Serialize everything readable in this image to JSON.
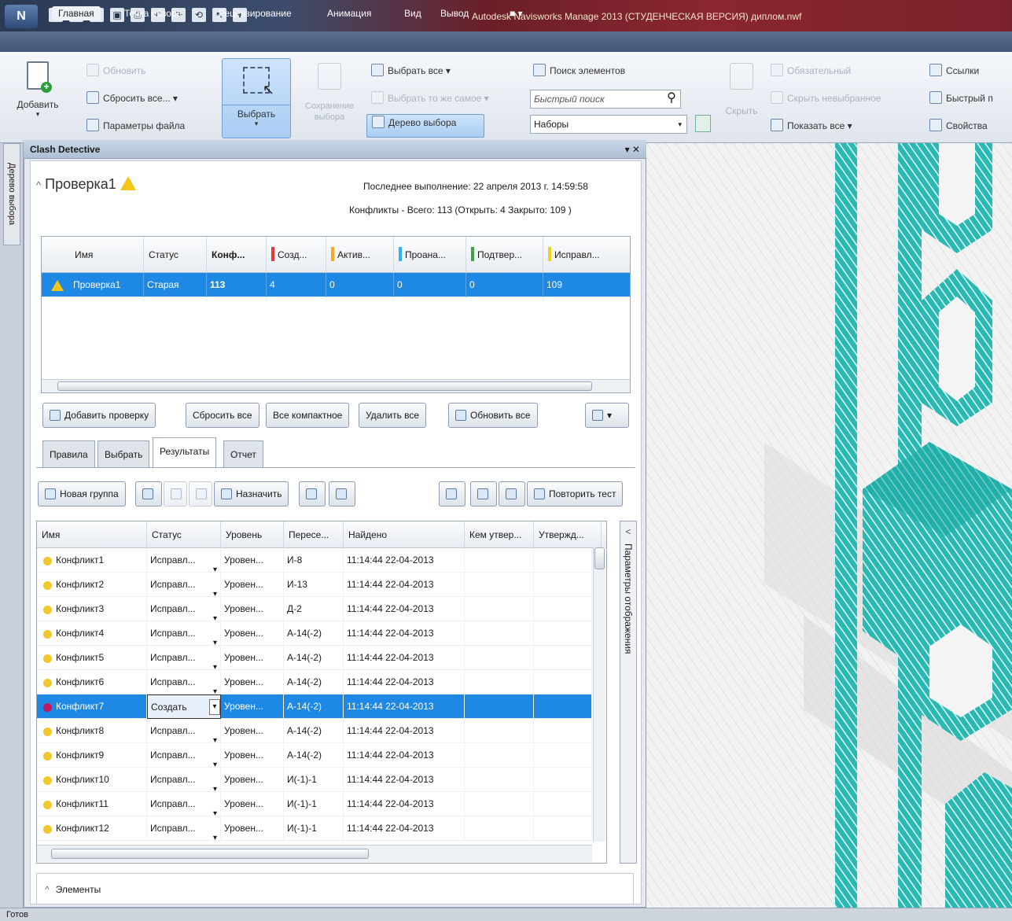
{
  "app": {
    "title": "Autodesk Navisworks Manage 2013 (СТУДЕНЧЕСКАЯ ВЕРСИЯ)  диплом.nwf",
    "menu_button": "N"
  },
  "quick_access": [
    "▢",
    "▤",
    "▾",
    "▣",
    "⎙",
    "↶",
    "↷",
    "⟲",
    "↖",
    "▾"
  ],
  "tabs": [
    "Главная",
    "Точка обзора",
    "Рецензирование",
    "Анимация",
    "Вид",
    "Вывод",
    "■ ▾"
  ],
  "ribbon": {
    "add": "Добавить",
    "refresh": "Обновить",
    "reset_all": "Сбросить все... ▾",
    "file_params": "Параметры файла",
    "select": "Выбрать",
    "save_selection": "Сохранение выбора",
    "select_all": "Выбрать все ▾",
    "select_same": "Выбрать то же самое ▾",
    "selection_tree": "Дерево выбора",
    "find_items": "Поиск элементов",
    "quick_search_placeholder": "Быстрый поиск",
    "sets": "Наборы",
    "hide": "Скрыть",
    "required": "Обязательный",
    "hide_unselected": "Скрыть невыбранное",
    "show_all": "Показать все ▾",
    "links": "Ссылки",
    "quick_props": "Быстрый п",
    "properties": "Свойства"
  },
  "side_tab": "Дерево выбора",
  "status_bar": "Готов",
  "clash": {
    "panel_title": "Clash Detective",
    "panel_controls": "▾ ✕",
    "test_name": "Проверка1",
    "last_run": "Последнее выполнение:  22 апреля 2013 г. 14:59:58",
    "summary": "Конфликты - Всего: 113  (Открыть: 4  Закрыто: 109 )",
    "tests_columns": [
      "Имя",
      "Статус",
      "Конф...",
      "Созд...",
      "Актив...",
      "Проана...",
      "Подтвер...",
      "Исправл..."
    ],
    "tests_column_colors": [
      "",
      "",
      "",
      "#e53935",
      "#f5a623",
      "#29b6f6",
      "#43a047",
      "#f1d21c"
    ],
    "tests_row": [
      "Проверка1",
      "Старая",
      "113",
      "4",
      "0",
      "0",
      "0",
      "109"
    ],
    "test_buttons": {
      "add_test": "Добавить проверку",
      "reset_all": "Сбросить все",
      "compact_all": "Все компактное",
      "delete_all": "Удалить все",
      "update_all": "Обновить все"
    },
    "sub_tabs": [
      "Правила",
      "Выбрать",
      "Результаты",
      "Отчет"
    ],
    "results_toolbar": {
      "new_group": "Новая группа",
      "assign": "Назначить",
      "rerun": "Повторить тест"
    },
    "results_columns": [
      "Имя",
      "Статус",
      "Уровень",
      "Пересе...",
      "Найдено",
      "Кем утвер...",
      "Утвержд..."
    ],
    "results": [
      {
        "name": "Конфликт1",
        "status": "Исправл...",
        "level": "Уровен...",
        "grid": "И-8",
        "found": "11:14:44 22-04-2013",
        "dot": "#f2c72c"
      },
      {
        "name": "Конфликт2",
        "status": "Исправл...",
        "level": "Уровен...",
        "grid": "И-13",
        "found": "11:14:44 22-04-2013",
        "dot": "#f2c72c"
      },
      {
        "name": "Конфликт3",
        "status": "Исправл...",
        "level": "Уровен...",
        "grid": "Д-2",
        "found": "11:14:44 22-04-2013",
        "dot": "#f2c72c"
      },
      {
        "name": "Конфликт4",
        "status": "Исправл...",
        "level": "Уровен...",
        "grid": "А-14(-2)",
        "found": "11:14:44 22-04-2013",
        "dot": "#f2c72c"
      },
      {
        "name": "Конфликт5",
        "status": "Исправл...",
        "level": "Уровен...",
        "grid": "А-14(-2)",
        "found": "11:14:44 22-04-2013",
        "dot": "#f2c72c"
      },
      {
        "name": "Конфликт6",
        "status": "Исправл...",
        "level": "Уровен...",
        "grid": "А-14(-2)",
        "found": "11:14:44 22-04-2013",
        "dot": "#f2c72c"
      },
      {
        "name": "Конфликт7",
        "status": "Создать",
        "level": "Уровен...",
        "grid": "А-14(-2)",
        "found": "11:14:44 22-04-2013",
        "dot": "#c2185b"
      },
      {
        "name": "Конфликт8",
        "status": "Исправл...",
        "level": "Уровен...",
        "grid": "А-14(-2)",
        "found": "11:14:44 22-04-2013",
        "dot": "#f2c72c"
      },
      {
        "name": "Конфликт9",
        "status": "Исправл...",
        "level": "Уровен...",
        "grid": "А-14(-2)",
        "found": "11:14:44 22-04-2013",
        "dot": "#f2c72c"
      },
      {
        "name": "Конфликт10",
        "status": "Исправл...",
        "level": "Уровен...",
        "grid": "И(-1)-1",
        "found": "11:14:44 22-04-2013",
        "dot": "#f2c72c"
      },
      {
        "name": "Конфликт11",
        "status": "Исправл...",
        "level": "Уровен...",
        "grid": "И(-1)-1",
        "found": "11:14:44 22-04-2013",
        "dot": "#f2c72c"
      },
      {
        "name": "Конфликт12",
        "status": "Исправл...",
        "level": "Уровен...",
        "grid": "И(-1)-1",
        "found": "11:14:44 22-04-2013",
        "dot": "#f2c72c"
      }
    ],
    "selected_result": 6,
    "display_params": "Параметры отображения",
    "items_section": "Элементы"
  },
  "colors": {
    "selection": "#1e88e5",
    "teal": "#22b3b0",
    "warning": "#f5c518"
  }
}
